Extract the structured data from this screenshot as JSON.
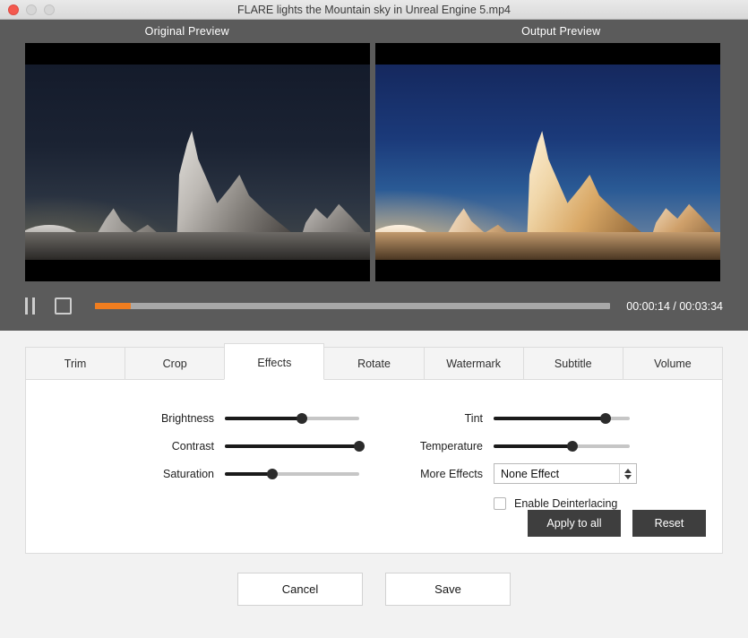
{
  "window": {
    "title": "FLARE lights the Mountain sky in Unreal Engine 5.mp4",
    "traffic_lights": {
      "close": "close-button",
      "minimize": "minimize-button",
      "maximize": "maximize-button"
    }
  },
  "preview": {
    "original_label": "Original Preview",
    "output_label": "Output  Preview"
  },
  "transport": {
    "pause_icon": "pause-icon",
    "stop_icon": "stop-icon",
    "progress_percent": 7,
    "time": "00:00:14 / 00:03:34",
    "current_time": "00:00:14",
    "total_time": "00:03:34",
    "fill_color": "#f07d1f"
  },
  "tabs": [
    {
      "label": "Trim",
      "active": false
    },
    {
      "label": "Crop",
      "active": false
    },
    {
      "label": "Effects",
      "active": true
    },
    {
      "label": "Rotate",
      "active": false
    },
    {
      "label": "Watermark",
      "active": false
    },
    {
      "label": "Subtitle",
      "active": false
    },
    {
      "label": "Volume",
      "active": false
    }
  ],
  "effects": {
    "sliders_left": [
      {
        "label": "Brightness",
        "value": 57
      },
      {
        "label": "Contrast",
        "value": 100
      },
      {
        "label": "Saturation",
        "value": 35
      }
    ],
    "sliders_right": [
      {
        "label": "Tint",
        "value": 82
      },
      {
        "label": "Temperature",
        "value": 58
      }
    ],
    "more_effects": {
      "label": "More Effects",
      "selected": "None Effect"
    },
    "deinterlacing": {
      "label": "Enable Deinterlacing",
      "checked": false
    },
    "apply_to_all_label": "Apply to all",
    "reset_label": "Reset"
  },
  "footer": {
    "cancel_label": "Cancel",
    "save_label": "Save"
  }
}
